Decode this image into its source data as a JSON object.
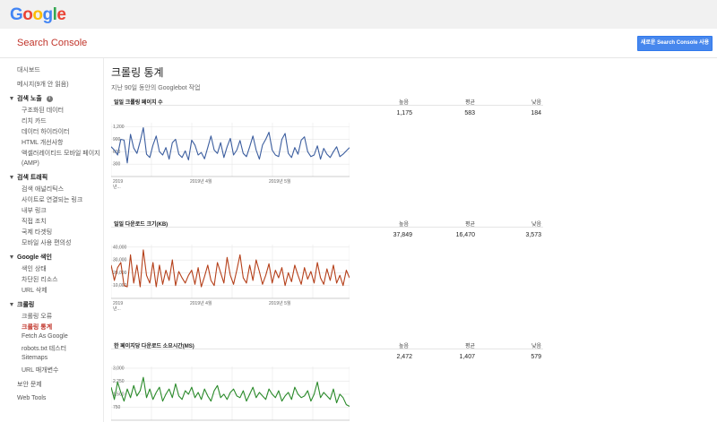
{
  "brand": {
    "logo_letters": [
      {
        "char": "G",
        "color": "#4285f4"
      },
      {
        "char": "o",
        "color": "#ea4335"
      },
      {
        "char": "o",
        "color": "#fbbc05"
      },
      {
        "char": "g",
        "color": "#4285f4"
      },
      {
        "char": "l",
        "color": "#34a853"
      },
      {
        "char": "e",
        "color": "#ea4335"
      }
    ]
  },
  "header": {
    "product": "Search Console",
    "new_button": "새로운 Search Console 사용"
  },
  "sidebar": {
    "dashboard": "대시보드",
    "messages": "메시지(9개 안 읽음)",
    "search_appearance": "검색 노출",
    "info_icon_glyph": "i",
    "search_appearance_items": [
      "구조화된 데이터",
      "리치 카드",
      "데이터 하이라이터",
      "HTML 개선사항",
      "액셀러레이티드 모바일 페이지(AMP)"
    ],
    "search_traffic": "검색 트래픽",
    "search_traffic_items": [
      "검색 애널리틱스",
      "사이트로 연결되는 링크",
      "내부 링크",
      "직접 조치",
      "국제 타겟팅",
      "모바일 사용 편의성"
    ],
    "google_index": "Google 색인",
    "google_index_items": [
      "색인 상태",
      "차단된 리소스",
      "URL 삭제"
    ],
    "crawl": "크롤링",
    "crawl_items": [
      "크롤링 오류",
      "크롤링 통계",
      "Fetch As Google",
      "robots.txt 테스터",
      "Sitemaps",
      "URL 매개변수"
    ],
    "security": "보안 문제",
    "web_tools": "Web Tools"
  },
  "main": {
    "title": "크롤링 통계",
    "subtitle": "지난 90일 동안의 Googlebot 작업",
    "col_high": "높음",
    "col_avg": "평균",
    "col_low": "낮음"
  },
  "sections": [
    {
      "title": "일일 크롤링 페이지 수",
      "high": "1,175",
      "avg": "583",
      "low": "184",
      "color": "#3c5e9f",
      "x_labels": [
        "2019\n년...",
        "2019년 4월",
        "2019년 5월"
      ],
      "y_ticks": [
        "1,200",
        "900",
        "600",
        "300"
      ]
    },
    {
      "title": "일일 다운로드 크기(KB)",
      "high": "37,849",
      "avg": "16,470",
      "low": "3,573",
      "color": "#b5401a",
      "x_labels": [
        "2019\n년...",
        "2019년 4월",
        "2019년 5월"
      ],
      "y_ticks": [
        "40,000",
        "30,000",
        "20,000",
        "10,000"
      ]
    },
    {
      "title": "한 페이지당 다운로드 소요시간(MS)",
      "high": "2,472",
      "avg": "1,407",
      "low": "579",
      "color": "#2a8a2a",
      "x_labels": [],
      "y_ticks": [
        "3,000",
        "2,250",
        "1,500",
        "750"
      ]
    }
  ],
  "chart_data": [
    {
      "type": "line",
      "title": "일일 크롤링 페이지 수",
      "ylim": [
        0,
        1300
      ],
      "y_ticks": [
        1200,
        900,
        600,
        300
      ],
      "x_tick_labels": [
        "2019 년...",
        "2019년 4월",
        "2019년 5월"
      ],
      "series": [
        {
          "values": [
            720,
            640,
            520,
            900,
            880,
            330,
            1020,
            690,
            560,
            850,
            1180,
            540,
            460,
            760,
            980,
            600,
            520,
            700,
            420,
            820,
            900,
            540,
            460,
            620,
            400,
            880,
            760,
            520,
            580,
            430,
            700,
            980,
            640,
            560,
            820,
            460,
            720,
            920,
            520,
            640,
            870,
            560,
            480,
            720,
            980,
            640,
            420,
            760,
            900,
            1070,
            640,
            520,
            480,
            900,
            1040,
            560,
            460,
            700,
            540,
            880,
            960,
            600,
            480,
            520,
            740,
            420,
            680,
            540,
            460,
            600,
            720,
            480,
            540,
            620,
            700
          ]
        }
      ]
    },
    {
      "type": "line",
      "title": "일일 다운로드 크기(KB)",
      "ylim": [
        0,
        42000
      ],
      "y_ticks": [
        40000,
        30000,
        20000,
        10000
      ],
      "x_tick_labels": [
        "2019 년...",
        "2019년 4월",
        "2019년 5월"
      ],
      "series": [
        {
          "values": [
            26000,
            14000,
            24000,
            28000,
            10000,
            9000,
            34000,
            12000,
            26000,
            9000,
            37849,
            18000,
            12000,
            28000,
            9000,
            26000,
            11000,
            22000,
            14000,
            30000,
            10000,
            21000,
            16000,
            12000,
            18000,
            22000,
            11000,
            24000,
            9000,
            17000,
            26000,
            14000,
            10000,
            28000,
            20000,
            12000,
            32000,
            18000,
            11000,
            22000,
            34000,
            16000,
            12000,
            26000,
            14000,
            30000,
            21000,
            11000,
            18000,
            27000,
            12000,
            22000,
            16000,
            24000,
            10000,
            20000,
            13000,
            26000,
            18000,
            11000,
            24000,
            15000,
            21000,
            12000,
            28000,
            16000,
            11000,
            23000,
            14000,
            26000,
            12000,
            18000,
            10000,
            22000,
            16000
          ]
        }
      ]
    },
    {
      "type": "line",
      "title": "한 페이지당 다운로드 소요시간(MS)",
      "ylim": [
        0,
        3100
      ],
      "y_ticks": [
        3000,
        2250,
        1500,
        750
      ],
      "series": [
        {
          "values": [
            1900,
            1200,
            2200,
            1600,
            1100,
            1800,
            1300,
            2000,
            1400,
            1700,
            2472,
            1300,
            1800,
            1200,
            1600,
            1900,
            1100,
            1500,
            1800,
            1300,
            2100,
            1400,
            1200,
            1700,
            1500,
            1900,
            1300,
            1600,
            1200,
            1800,
            1400,
            1100,
            1700,
            2000,
            1300,
            1500,
            1200,
            1600,
            1800,
            1400,
            1300,
            1700,
            1100,
            1500,
            1900,
            1300,
            1600,
            1400,
            1200,
            1800,
            1500,
            1300,
            1700,
            1100,
            1400,
            1600,
            1200,
            1900,
            1500,
            1300,
            1400,
            1700,
            1100,
            1500,
            2200,
            1300,
            1600,
            1400,
            1200,
            1800,
            1000,
            1500,
            1300,
            900,
            800
          ]
        }
      ]
    }
  ]
}
